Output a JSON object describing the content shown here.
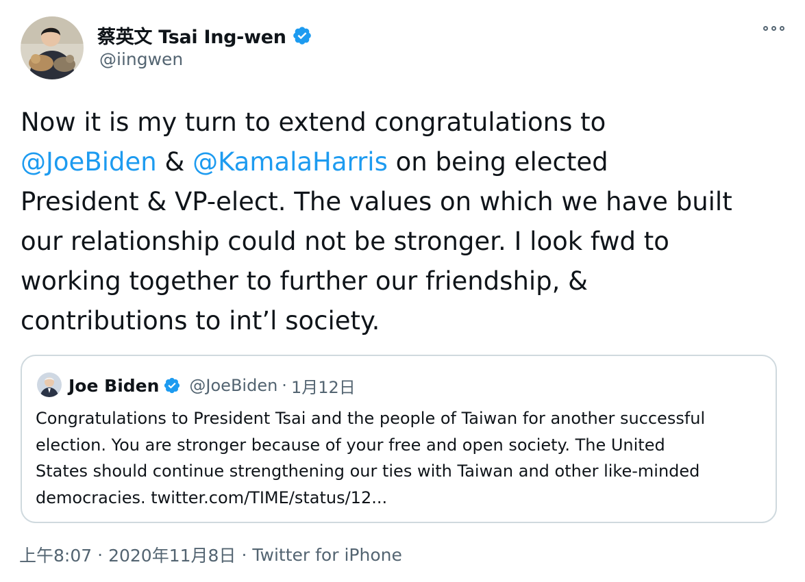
{
  "author": {
    "display_name": "蔡英文 Tsai Ing-wen",
    "handle": "@iingwen",
    "verified": true
  },
  "tweet": {
    "lines": [
      [
        {
          "t": "Now it is my turn to extend congratulations to",
          "m": false
        }
      ],
      [
        {
          "t": "@JoeBiden",
          "m": true
        },
        {
          "t": " & ",
          "m": false
        },
        {
          "t": "@KamalaHarris",
          "m": true
        },
        {
          "t": " on being elected",
          "m": false
        }
      ],
      [
        {
          "t": "President & VP-elect. The values on which we have built",
          "m": false
        }
      ],
      [
        {
          "t": "our relationship could not be stronger. I look fwd to",
          "m": false
        }
      ],
      [
        {
          "t": "working together to further our friendship, &",
          "m": false
        }
      ],
      [
        {
          "t": "contributions to int’l society.",
          "m": false
        }
      ]
    ]
  },
  "quoted": {
    "name": "Joe Biden",
    "handle": "@JoeBiden",
    "separator": "·",
    "date": "1月12日",
    "lines": [
      "Congratulations to President Tsai and the people of Taiwan for another successful",
      "election. You are stronger because of your free and open society. The United",
      "States should continue strengthening our ties with Taiwan and other like-minded",
      "democracies. twitter.com/TIME/status/12..."
    ]
  },
  "meta": {
    "time": "上午8:07",
    "date": "2020年11月8日",
    "source": "Twitter for iPhone",
    "separator": "·"
  },
  "colors": {
    "mention": "#1d9bf0",
    "verified": "#1d9bf0",
    "secondary_text": "#536471",
    "card_border": "#cfd9de"
  },
  "icons": {
    "verified": "verified-badge-icon",
    "more": "more-options-icon"
  }
}
